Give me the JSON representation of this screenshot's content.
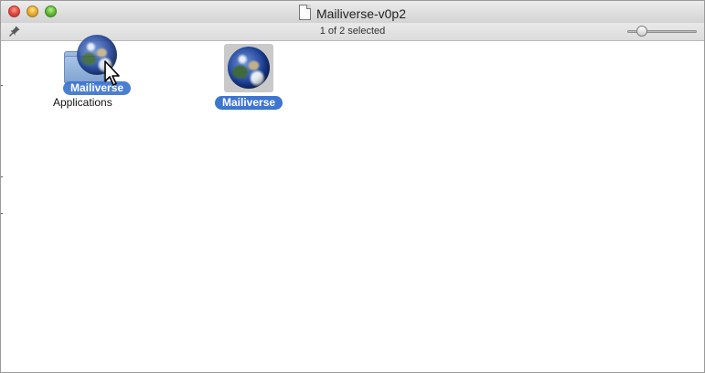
{
  "window": {
    "title": "Mailiverse-v0p2",
    "status_text": "1 of 2 selected"
  },
  "toolbar": {
    "left_icon": "pin-icon",
    "icon_size_slider": {
      "value": 0.15
    }
  },
  "items": [
    {
      "type": "folder-alias",
      "label": "Applications",
      "icon": "folder-icon"
    },
    {
      "type": "app",
      "label": "Mailiverse",
      "icon": "globe-icon",
      "selected": true
    }
  ],
  "drag": {
    "dragged_label": "Mailiverse",
    "dragged_icon": "globe-icon",
    "cursor_icon": "pointer-cursor-icon"
  },
  "colors": {
    "selection": "#3d75cf",
    "close": "#e0443e",
    "minimize": "#e6a92c",
    "zoom": "#5fb533"
  }
}
